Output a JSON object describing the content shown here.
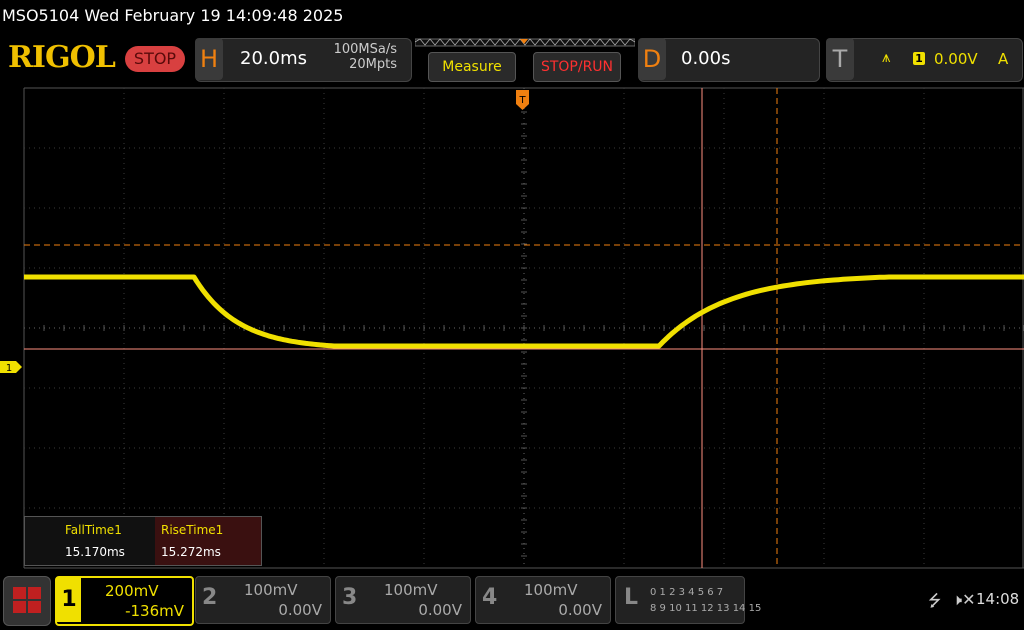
{
  "title": "MSO5104  Wed February 19 14:09:48 2025",
  "logo": "RIGOL",
  "run_state": "STOP",
  "horizontal": {
    "letter": "H",
    "timebase": "20.0ms",
    "sample_rate": "100MSa/s",
    "memory_depth": "20Mpts"
  },
  "buttons": {
    "measure": "Measure",
    "stop_run": "STOP/RUN"
  },
  "delay": {
    "letter": "D",
    "value": "0.00s"
  },
  "trigger": {
    "letter": "T",
    "edge_icon": "rising-edge-icon",
    "channel": "1",
    "level": "0.00V",
    "mode": "A"
  },
  "waveform": {
    "channel": "1",
    "color": "#f0e000",
    "high_level_div": 0.85,
    "low_level_div": -0.3,
    "fall_start_div": -3.3,
    "rise_start_div": 1.35
  },
  "cursors": {
    "color": "#ff9080"
  },
  "measurements": {
    "labels": [
      "FallTime1",
      "RiseTime1"
    ],
    "values": [
      "15.170ms",
      "15.272ms"
    ]
  },
  "channels": [
    {
      "num": "1",
      "scale": "200mV",
      "offset": "-136mV"
    },
    {
      "num": "2",
      "scale": "100mV",
      "offset": "0.00V"
    },
    {
      "num": "3",
      "scale": "100mV",
      "offset": "0.00V"
    },
    {
      "num": "4",
      "scale": "100mV",
      "offset": "0.00V"
    }
  ],
  "logic": {
    "letter": "L",
    "row1": "0 1 2 3   4 5 6 7",
    "row2": "8  9 10 11  12 13 14 15"
  },
  "status": {
    "usb_icon": "usb-icon",
    "sound_icon": "mute-icon",
    "time": "14:08"
  }
}
